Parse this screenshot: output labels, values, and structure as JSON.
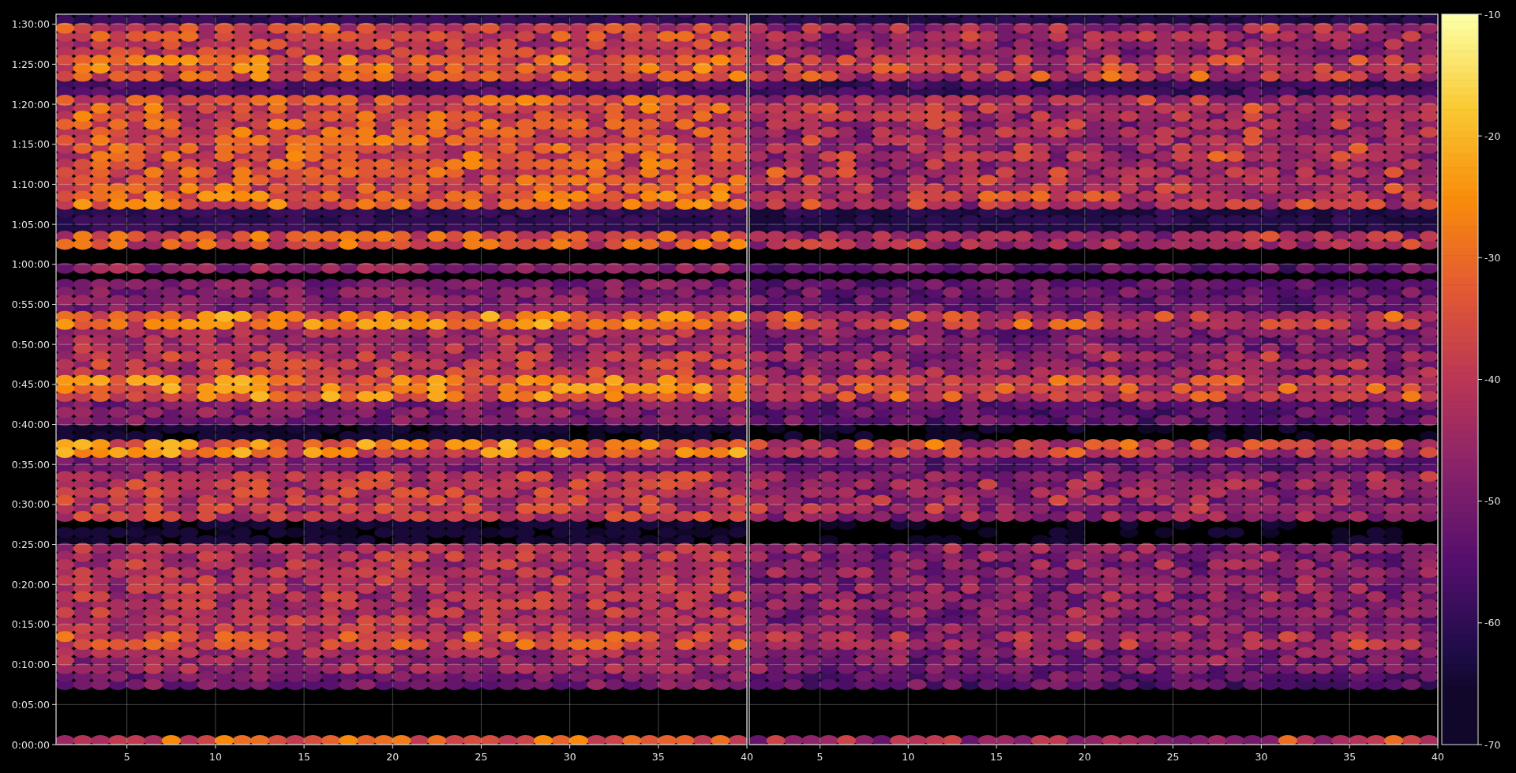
{
  "y_ticks": [
    "1:30:00",
    "1:25:00",
    "1:20:00",
    "1:15:00",
    "1:10:00",
    "1:05:00",
    "1:00:00",
    "0:55:00",
    "0:50:00",
    "0:45:00",
    "0:40:00",
    "0:35:00",
    "0:30:00",
    "0:25:00",
    "0:20:00",
    "0:15:00",
    "0:10:00",
    "0:05:00",
    "0:00:00"
  ],
  "panels": [
    {
      "x_ticks": [
        "5",
        "10",
        "15",
        "20",
        "25",
        "30",
        "35",
        "40"
      ]
    },
    {
      "x_ticks": [
        "5",
        "10",
        "15",
        "20",
        "25",
        "30",
        "35",
        "40"
      ]
    }
  ],
  "colorbar": {
    "ticks": [
      "-10",
      "-20",
      "-30",
      "-40",
      "-50",
      "-60",
      "-70"
    ]
  }
}
